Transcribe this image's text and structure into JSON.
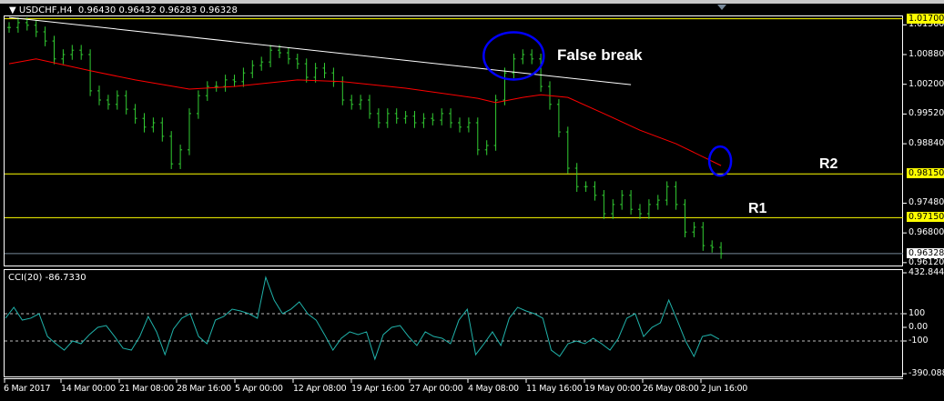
{
  "header": {
    "symbol": "USDCHF,H4",
    "ohlc": "0.96430 0.96432 0.96283 0.96328",
    "menu_icon": "triangle-down-icon"
  },
  "annotations": {
    "false_break": "False break",
    "r2": "R2",
    "r1": "R1"
  },
  "colors": {
    "bars": "#32cd32",
    "ma": "#ff0000",
    "trendline": "#ffffff",
    "levels": "#ffff00",
    "cci": "#20b2aa",
    "ellipse": "#0000ff",
    "current_price_line": "#778899"
  },
  "chart_data": [
    {
      "type": "bar",
      "title": "USDCHF,H4",
      "ylim": [
        0.959,
        1.018
      ],
      "y_ticks": [
        "1.01560",
        "1.00880",
        "1.00200",
        "0.99520",
        "0.98840",
        "0.97480",
        "0.96800",
        "0.96120"
      ],
      "y_tick_values": [
        1.0156,
        1.0088,
        1.002,
        0.9952,
        0.9884,
        0.9748,
        0.968,
        0.9612
      ],
      "x_ticks": [
        "6 Mar 2017",
        "14 Mar 00:00",
        "21 Mar 08:00",
        "28 Mar 16:00",
        "5 Apr 00:00",
        "12 Apr 08:00",
        "19 Apr 16:00",
        "27 Apr 00:00",
        "4 May 08:00",
        "11 May 16:00",
        "19 May 00:00",
        "26 May 08:00",
        "2 Jun 16:00"
      ],
      "closes": [
        1.015,
        1.0161,
        1.0155,
        1.014,
        1.0119,
        1.0078,
        1.0088,
        1.0098,
        1.0088,
        1.0005,
        0.9984,
        0.9974,
        0.9994,
        0.9963,
        0.9942,
        0.9922,
        0.9932,
        0.9901,
        0.9838,
        0.987,
        0.9953,
        0.9994,
        1.0015,
        1.0015,
        1.003,
        1.0026,
        1.0046,
        1.0063,
        1.0071,
        1.0098,
        1.0092,
        1.0078,
        1.0067,
        1.0036,
        1.0057,
        1.0046,
        1.0026,
        0.9984,
        0.9974,
        0.9984,
        0.9953,
        0.9932,
        0.9953,
        0.9942,
        0.9947,
        0.9932,
        0.9942,
        0.9938,
        0.9953,
        0.9932,
        0.9922,
        0.9932,
        0.987,
        0.988,
        0.9984,
        1.0046,
        1.0078,
        1.0088,
        1.0078,
        1.0015,
        0.9974,
        0.9911,
        0.9828,
        0.9786,
        0.9786,
        0.9766,
        0.9724,
        0.9745,
        0.9766,
        0.9734,
        0.9724,
        0.9745,
        0.9755,
        0.9786,
        0.9745,
        0.9682,
        0.9693,
        0.9651,
        0.9647,
        0.96328
      ],
      "moving_average": [
        [
          0,
          1.0067
        ],
        [
          3,
          1.0078
        ],
        [
          9,
          1.0051
        ],
        [
          14,
          1.003
        ],
        [
          20,
          1.0009
        ],
        [
          25,
          1.0015
        ],
        [
          32,
          1.003
        ],
        [
          37,
          1.0026
        ],
        [
          44,
          1.0011
        ],
        [
          52,
          0.9988
        ],
        [
          54,
          0.9978
        ],
        [
          57,
          0.999
        ],
        [
          59,
          0.9996
        ],
        [
          62,
          0.999
        ],
        [
          66,
          0.9953
        ],
        [
          70,
          0.9915
        ],
        [
          74,
          0.9884
        ],
        [
          79,
          0.9834
        ]
      ],
      "trendline": [
        [
          0,
          1.0173
        ],
        [
          69,
          1.0019
        ]
      ],
      "levels": [
        {
          "value": 1.017,
          "label": "1.01700",
          "color": "#ffff00"
        },
        {
          "value": 0.9815,
          "label": "0.98150",
          "color": "#ffff00"
        },
        {
          "value": 0.9715,
          "label": "0.97150",
          "color": "#ffff00"
        },
        {
          "value": 0.96328,
          "label": "0.96328",
          "color": "#778899",
          "current": true
        }
      ],
      "highlights": [
        {
          "center_bar": 57,
          "center_value": 1.0085
        },
        {
          "center_bar": 79,
          "center_value": 0.9836
        }
      ]
    },
    {
      "type": "line",
      "title": "CCI(20) -86.7330",
      "ylim": [
        -390.0885,
        432.8441
      ],
      "y_ticks": [
        "432.8441",
        "100",
        "0.00",
        "-100",
        "-390.0885"
      ],
      "y_tick_values": [
        432.8441,
        100,
        0,
        -100,
        -390.0885
      ],
      "reference_lines": [
        100,
        -100
      ],
      "values": [
        67,
        147,
        53,
        67,
        100,
        -67,
        -120,
        -167,
        -100,
        -120,
        -53,
        0,
        13,
        -67,
        -153,
        -167,
        -67,
        80,
        -33,
        -200,
        -13,
        67,
        100,
        -67,
        -120,
        53,
        80,
        133,
        120,
        100,
        67,
        367,
        200,
        100,
        133,
        187,
        100,
        53,
        -53,
        -167,
        -80,
        -33,
        -53,
        -33,
        -233,
        -53,
        0,
        13,
        -67,
        -133,
        -33,
        -67,
        -80,
        -120,
        53,
        133,
        -200,
        -120,
        -33,
        -133,
        67,
        147,
        120,
        100,
        67,
        -167,
        -213,
        -120,
        -100,
        -120,
        -80,
        -120,
        -167,
        -80,
        67,
        100,
        -67,
        0,
        33,
        200,
        53,
        -100,
        -213,
        -67,
        -53,
        -86.733
      ]
    }
  ]
}
